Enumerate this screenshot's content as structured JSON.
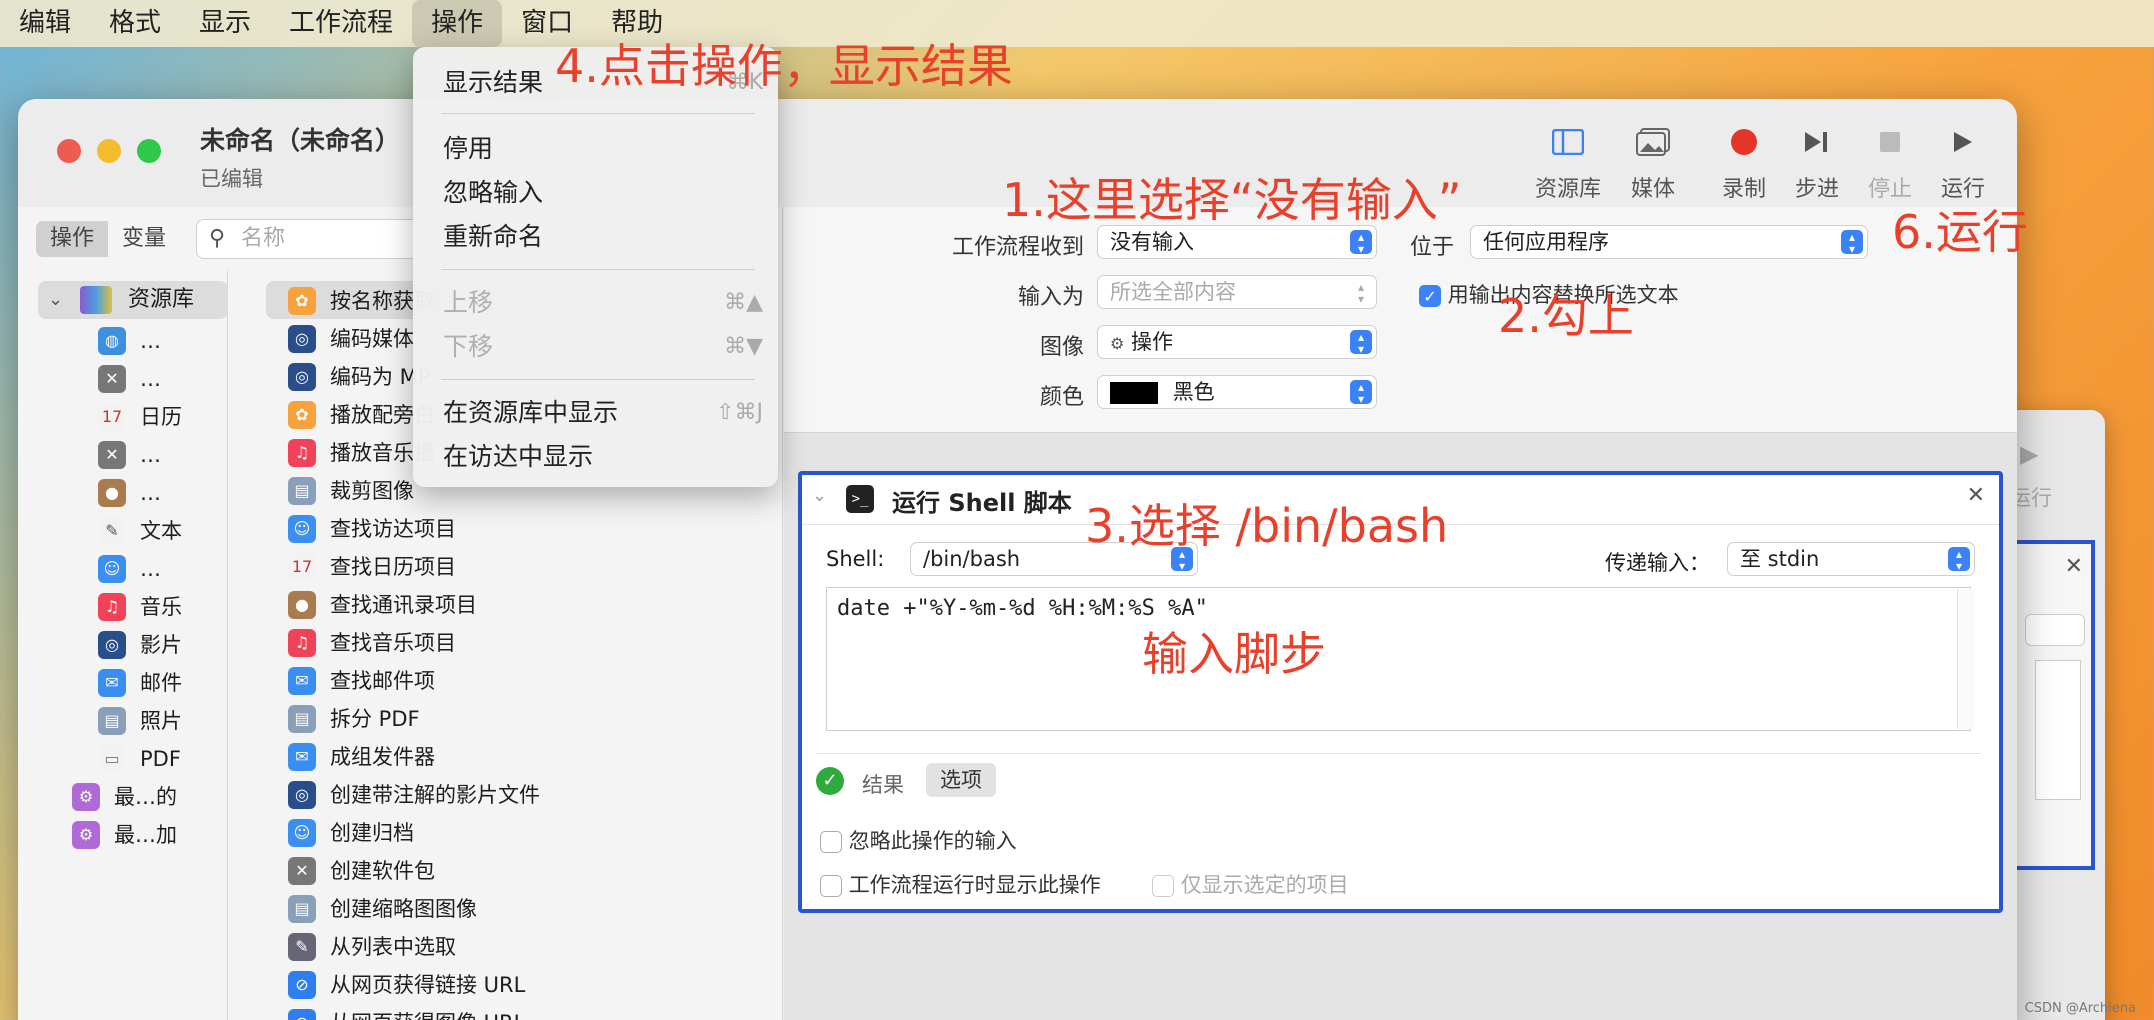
{
  "menubar": [
    "编辑",
    "格式",
    "显示",
    "工作流程",
    "操作",
    "窗口",
    "帮助"
  ],
  "window": {
    "title": "未命名（未命名）",
    "subtitle": "已编辑"
  },
  "toolbar": {
    "library": "资源库",
    "media": "媒体",
    "record": "录制",
    "step": "步进",
    "stop": "停止",
    "run": "运行"
  },
  "left": {
    "tab_actions": "操作",
    "tab_variables": "变量",
    "search_placeholder": "名称",
    "library_header": "资源库"
  },
  "library_items": [
    "…",
    "…",
    "日历",
    "…",
    "…",
    "文本",
    "…",
    "音乐",
    "影片",
    "邮件",
    "照片",
    "PDF",
    "最…的",
    "最…加"
  ],
  "actions": [
    "按名称获取",
    "编码媒体",
    "编码为 MP",
    "播放配旁白",
    "播放音乐播",
    "裁剪图像",
    "查找访达项目",
    "查找日历项目",
    "查找通讯录项目",
    "查找音乐项目",
    "查找邮件项",
    "拆分 PDF",
    "成组发件器",
    "创建带注解的影片文件",
    "创建归档",
    "创建软件包",
    "创建缩略图图像",
    "从列表中选取",
    "从网页获得链接 URL",
    "从网页获得图像 URL"
  ],
  "input": {
    "receives_label": "工作流程收到",
    "receives_value": "没有输入",
    "in_label": "位于",
    "in_value": "任何应用程序",
    "input_is_label": "输入为",
    "input_is_value": "所选全部内容",
    "replace_label": "用输出内容替换所选文本",
    "image_label": "图像",
    "image_value": "操作",
    "color_label": "颜色",
    "color_value": "黑色"
  },
  "card": {
    "title": "运行 Shell 脚本",
    "shell_label": "Shell:",
    "shell_value": "/bin/bash",
    "pass_label": "传递输入：",
    "pass_value": "至 stdin",
    "script": "date +\"%Y-%m-%d %H:%M:%S %A\"",
    "results_tab": "结果",
    "options_tab": "选项",
    "ignore_input": "忽略此操作的输入",
    "show_when_run": "工作流程运行时显示此操作",
    "show_selected": "仅显示选定的项目"
  },
  "menu": {
    "show_results": "显示结果",
    "show_results_key": "⌘K",
    "disable": "停用",
    "ignore_input": "忽略输入",
    "rename": "重新命名",
    "move_up": "上移",
    "move_up_key": "⌘▲",
    "move_down": "下移",
    "move_down_key": "⌘▼",
    "show_in_library": "在资源库中显示",
    "show_in_library_key": "⇧⌘J",
    "show_in_finder": "在访达中显示"
  },
  "back_window": {
    "run": "运行"
  },
  "annotations": {
    "a1": "1.这里选择“没有输入”",
    "a2": "2.勾上",
    "a3": "3.选择 /bin/bash",
    "a4": "4.点击操作，显示结果",
    "a5": "输入脚步",
    "a6": "6.运行"
  },
  "watermark": "CSDN @Archiena",
  "colors": {
    "accent": "#3b82f6",
    "annotation": "#e8402a",
    "card_border": "#2b55d0"
  }
}
